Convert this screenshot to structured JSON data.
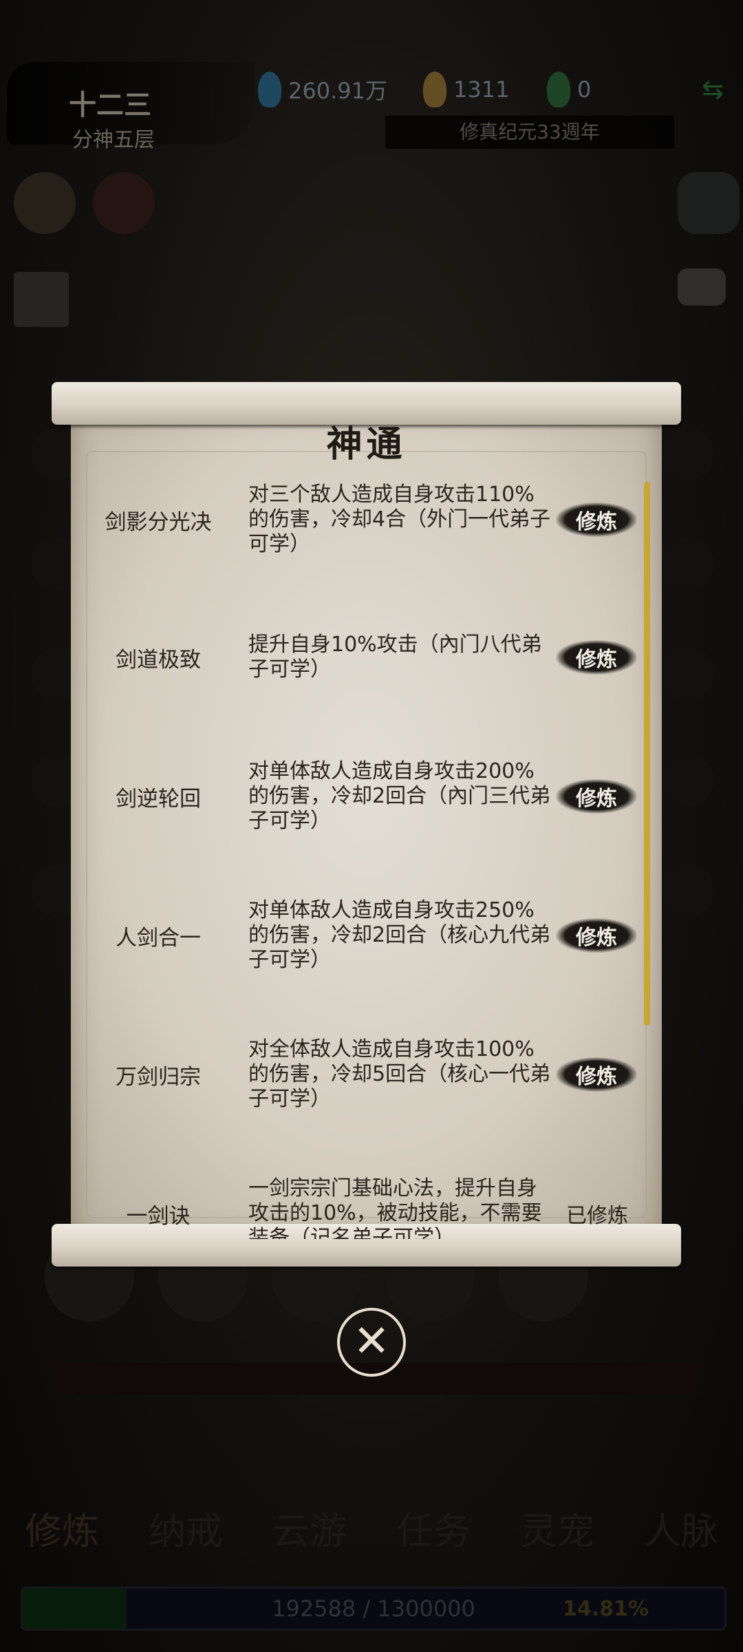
{
  "hud": {
    "char_name": "十二三",
    "realm": "分神五层",
    "spirit_stones": "260.91万",
    "gold": "1311",
    "jade": "0",
    "era": "修真纪元33週年"
  },
  "modal": {
    "title": "神通",
    "skills": [
      {
        "name": "剑影分光决",
        "desc": "对三个敌人造成自身攻击110%的伤害，冷却4合（外门一代弟子可学）",
        "action": "修炼"
      },
      {
        "name": "剑道极致",
        "desc": "提升自身10%攻击（內门八代弟子可学）",
        "action": "修炼"
      },
      {
        "name": "剑逆轮回",
        "desc": "对单体敌人造成自身攻击200%的伤害，冷却2回合（內门三代弟子可学）",
        "action": "修炼"
      },
      {
        "name": "人剑合一",
        "desc": "对单体敌人造成自身攻击250%的伤害，冷却2回合（核心九代弟子可学）",
        "action": "修炼"
      },
      {
        "name": "万剑归宗",
        "desc": "对全体敌人造成自身攻击100%的伤害，冷却5回合（核心一代弟子可学）",
        "action": "修炼"
      },
      {
        "name": "一剑诀",
        "desc": "一剑宗宗门基础心法，提升自身攻击的10%，被动技能，不需要装备（记名弟子可学）",
        "status": "已修炼"
      }
    ]
  },
  "nav": {
    "tabs": [
      "修炼",
      "纳戒",
      "云游",
      "任务",
      "灵宠",
      "人脉"
    ]
  },
  "exp": {
    "text": "192588 / 1300000",
    "percent": "14.81%",
    "fill_fraction": 0.1481
  },
  "icons": {
    "close": "close-x-icon"
  }
}
